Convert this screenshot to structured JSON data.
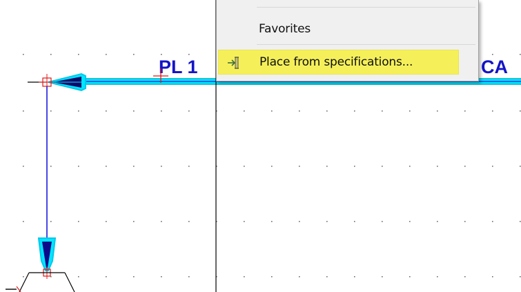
{
  "drawing": {
    "tag_text_left": "PL 1",
    "tag_text_right": "CA",
    "colors": {
      "background": "#ffffff",
      "grid_dot": "#6e6e6e",
      "pipe_highlight": "#00e6ff",
      "pipe_line": "#1a1adc",
      "tag_text": "#1414c8",
      "marker_red": "#e01818"
    }
  },
  "context_menu": {
    "items": [
      {
        "label": "Favorites",
        "icon": "",
        "highlighted": false
      },
      {
        "label": "Place from specifications...",
        "icon": "place-from-spec-icon",
        "highlighted": true
      }
    ],
    "highlight_color": "#f5f05a"
  }
}
